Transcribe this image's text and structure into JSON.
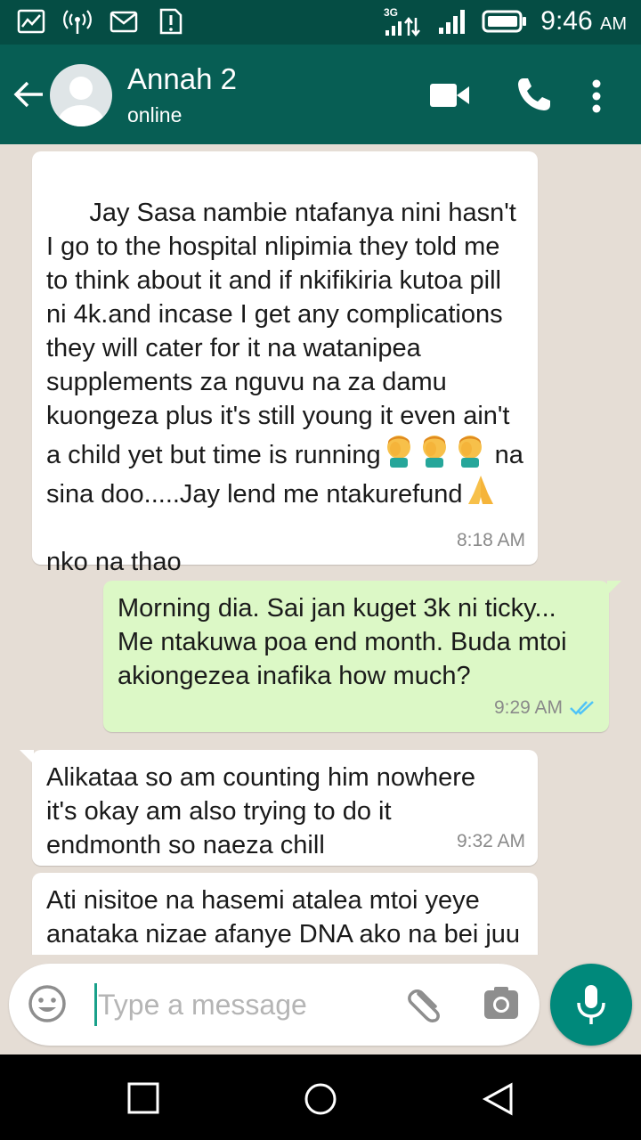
{
  "status_bar": {
    "time": "9:46",
    "ampm": "AM",
    "network": "3G"
  },
  "header": {
    "contact_name": "Annah 2",
    "contact_status": "online"
  },
  "messages": [
    {
      "direction": "incoming",
      "text_part1": "Jay Sasa nambie ntafanya nini hasn't I go to the hospital nlipimia they told me to think about it and if nkifikiria kutoa pill ni 4k.and incase I get any complications they will cater for it na watanipea supplements za nguvu na za damu kuongeza plus it's still young it even ain't a child yet but time is running",
      "emoji1": "face-palm-emoji",
      "text_part2": " na sina doo.....Jay lend me ntakurefund",
      "emoji2": "folded-hands-emoji",
      "text_part3": "nko na thao",
      "time": "8:18 AM"
    },
    {
      "direction": "outgoing",
      "text": "Morning dia. Sai jan kuget 3k ni ticky... Me ntakuwa poa end month. Buda mtoi akiongezea inafika how much?",
      "time": "9:29 AM",
      "status": "read"
    },
    {
      "direction": "incoming",
      "text": "Alikataa so am counting him nowhere it's okay am also trying to do it endmonth so naeza chill",
      "time": "9:32 AM"
    },
    {
      "direction": "incoming",
      "text": "Ati nisitoe na hasemi atalea mtoi yeye anataka nizae afanye DNA ako na bei juu DNA ni ja fw ai ni ju"
    }
  ],
  "composer": {
    "placeholder": "Type a message"
  },
  "colors": {
    "header": "#075e54",
    "status_bar": "#054d44",
    "outgoing_bubble": "#dcf8c6",
    "fab": "#00897b",
    "read_tick": "#4fc3f7"
  }
}
